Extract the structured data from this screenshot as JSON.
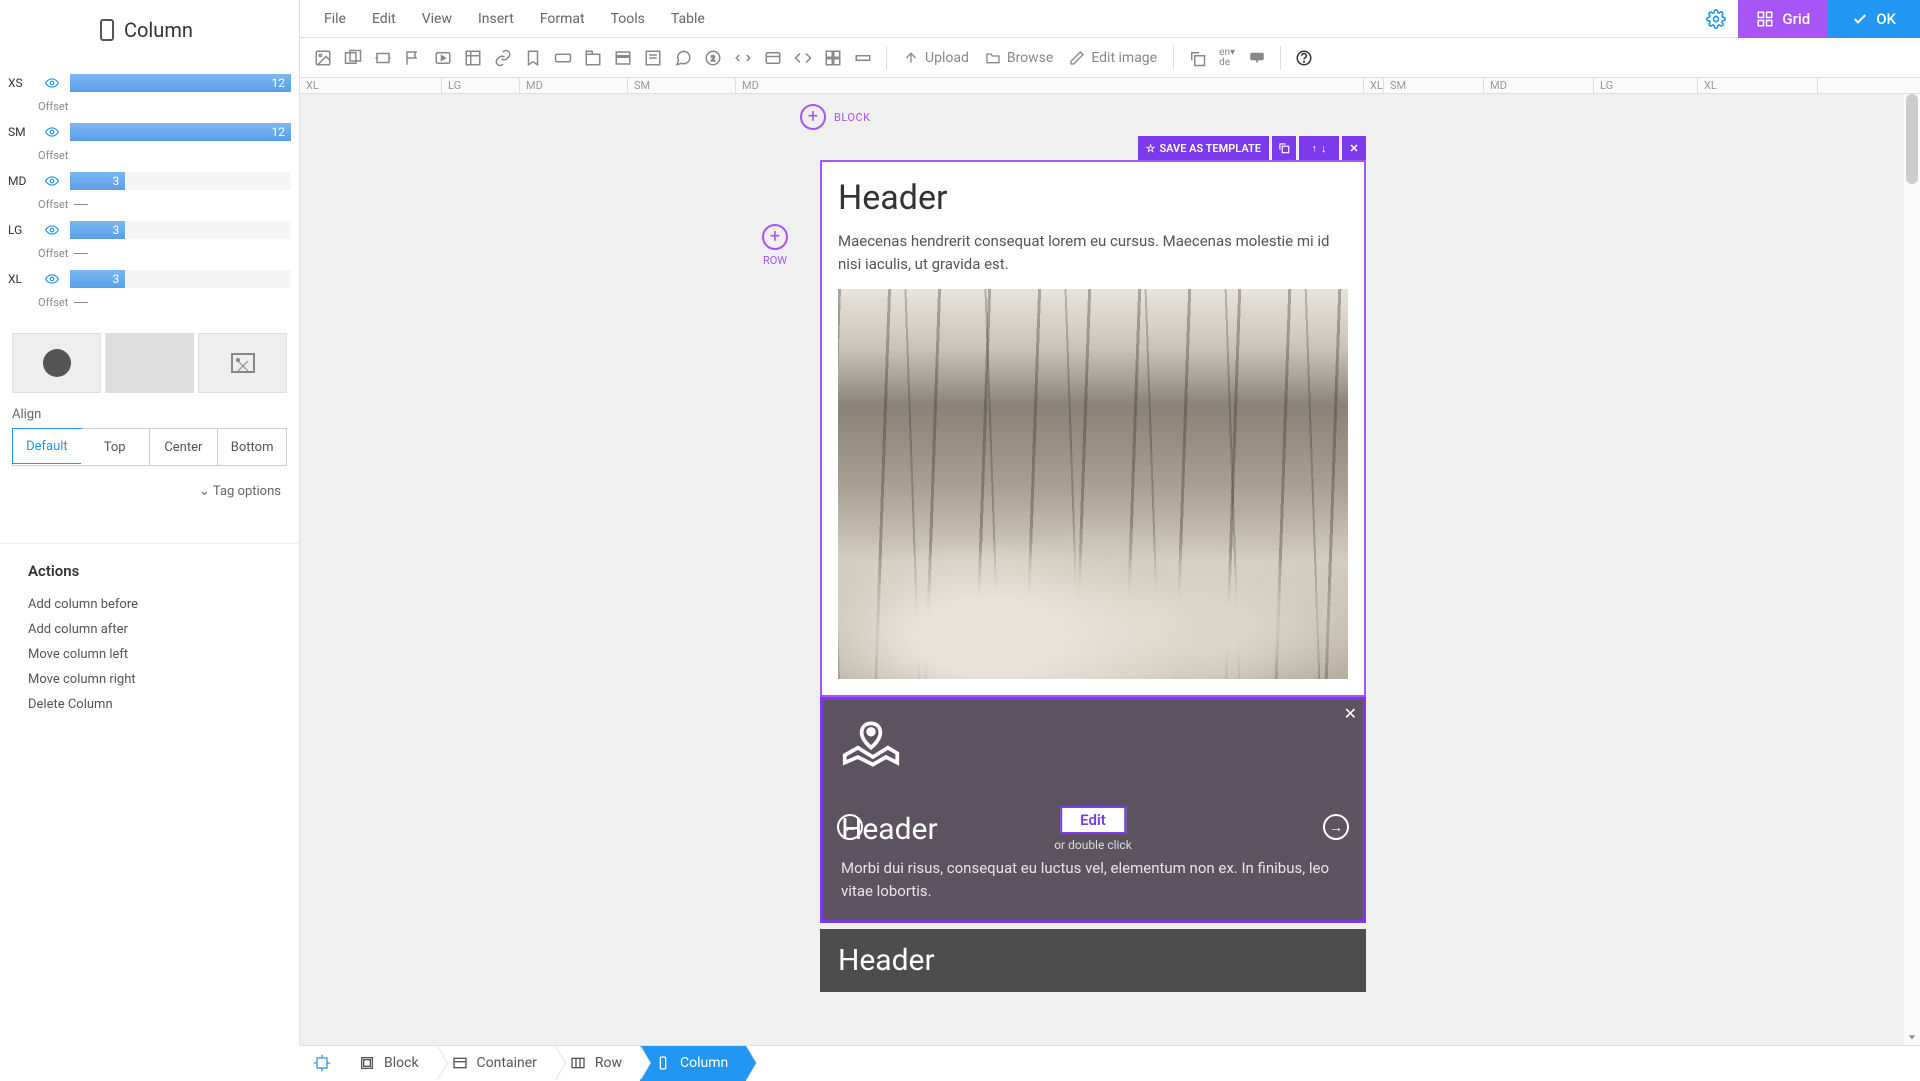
{
  "sidebar": {
    "title": "Column",
    "breakpoints": [
      {
        "label": "XS",
        "value": "12",
        "pct": 100,
        "offset_label": "Offset",
        "has_offset_line": false
      },
      {
        "label": "SM",
        "value": "12",
        "pct": 100,
        "offset_label": "Offset",
        "has_offset_line": false
      },
      {
        "label": "MD",
        "value": "3",
        "pct": 25,
        "offset_label": "Offset",
        "has_offset_line": true
      },
      {
        "label": "LG",
        "value": "3",
        "pct": 25,
        "offset_label": "Offset",
        "has_offset_line": true
      },
      {
        "label": "XL",
        "value": "3",
        "pct": 25,
        "offset_label": "Offset",
        "has_offset_line": true
      }
    ],
    "align_label": "Align",
    "align_options": [
      "Default",
      "Top",
      "Center",
      "Bottom"
    ],
    "align_selected": "Default",
    "tag_options": "Tag options",
    "actions_title": "Actions",
    "actions": [
      "Add column before",
      "Add column after",
      "Move column left",
      "Move column right",
      "Delete Column"
    ]
  },
  "menu": [
    "File",
    "Edit",
    "View",
    "Insert",
    "Format",
    "Tools",
    "Table"
  ],
  "topbar": {
    "grid": "Grid",
    "ok": "OK"
  },
  "toolbar": {
    "upload": "Upload",
    "browse": "Browse",
    "edit_image": "Edit image"
  },
  "ruler": [
    "XL",
    "LG",
    "MD",
    "SM",
    "MD",
    "XL",
    "SM",
    "MD",
    "LG",
    "XL"
  ],
  "ruler_widths": [
    142,
    78,
    108,
    108,
    628,
    20,
    100,
    110,
    104,
    120
  ],
  "block_label": "BLOCK",
  "row_label": "ROW",
  "card_toolbar": {
    "save": "SAVE AS TEMPLATE"
  },
  "card1": {
    "header": "Header",
    "text": "Maecenas hendrerit consequat lorem eu cursus. Maecenas molestie mi id nisi iaculis, ut gravida est."
  },
  "card2": {
    "header": "Header",
    "text": "Morbi dui risus, consequat eu luctus vel, elementum non ex. In finibus, leo vitae lobortis.",
    "edit": "Edit",
    "hint": "or double click"
  },
  "card3": {
    "header": "Header"
  },
  "breadcrumb": [
    {
      "label": "Block",
      "icon": "block"
    },
    {
      "label": "Container",
      "icon": "container"
    },
    {
      "label": "Row",
      "icon": "row"
    },
    {
      "label": "Column",
      "icon": "column"
    }
  ],
  "breadcrumb_active": "Column"
}
